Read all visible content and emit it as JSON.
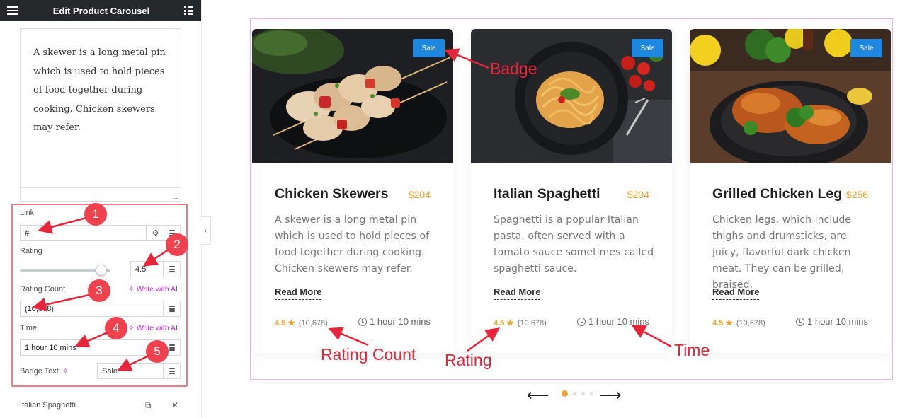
{
  "panel": {
    "title": "Edit Product Carousel",
    "description": "A skewer is a long metal pin which is used to hold pieces of food together during cooking. Chicken skewers may refer.",
    "fields": {
      "link_label": "Link",
      "link_value": "#",
      "rating_label": "Rating",
      "rating_value": "4.5",
      "rating_slider_fraction": 0.9,
      "rating_count_label": "Rating Count",
      "rating_count_value": "(10,678)",
      "time_label": "Time",
      "time_value": "1 hour 10 mins",
      "badge_label": "Badge Text",
      "badge_value": "Sale",
      "ai_link": "Write with AI"
    },
    "repeater_item": "Italian Spaghetti",
    "markers": [
      "1",
      "2",
      "3",
      "4",
      "5"
    ]
  },
  "cards": [
    {
      "badge": "Sale",
      "title": "Chicken Skewers",
      "price": "$204",
      "description": "A skewer is a long metal pin which is used to hold pieces of food together during cooking. Chicken skewers may refer.",
      "read_more": "Read More",
      "rating": "4.5",
      "rating_count": "(10,678)",
      "time": "1 hour 10 mins"
    },
    {
      "badge": "Sale",
      "title": "Italian Spaghetti",
      "price": "$204",
      "description": "Spaghetti is a popular Italian pasta, often served with a tomato sauce sometimes called spaghetti sauce.",
      "read_more": "Read More",
      "rating": "4.5",
      "rating_count": "(10,678)",
      "time": "1 hour 10 mins"
    },
    {
      "badge": "Sale",
      "title": "Grilled Chicken Leg",
      "price": "$256",
      "description": "Chicken legs, which include thighs and drumsticks, are juicy, flavorful dark chicken meat. They can be grilled, braised.",
      "read_more": "Read More",
      "rating": "4.5",
      "rating_count": "(10,678)",
      "time": "1 hour 10 mins"
    }
  ],
  "annotations": {
    "badge": "Badge",
    "rating_count": "Rating Count",
    "rating": "Rating",
    "time": "Time"
  },
  "navigation": {
    "prev_arrow": "⟵",
    "next_arrow": "⟶",
    "dot_count": 4,
    "active_dot": 0
  },
  "colors": {
    "accent_orange": "#f0a12b",
    "badge_blue": "#1e87e0",
    "annotation_red": "#e8263b",
    "ai_purple": "#c026d3",
    "header_dark": "#26292c"
  },
  "icons": [
    "hamburger-icon",
    "apps-grid-icon",
    "gear-icon",
    "dynamic-tags-icon",
    "ai-sparkle-icon",
    "duplicate-icon",
    "close-icon",
    "collapse-chevron-icon",
    "clock-icon",
    "star-icon",
    "arrow-left-icon",
    "arrow-right-icon"
  ]
}
